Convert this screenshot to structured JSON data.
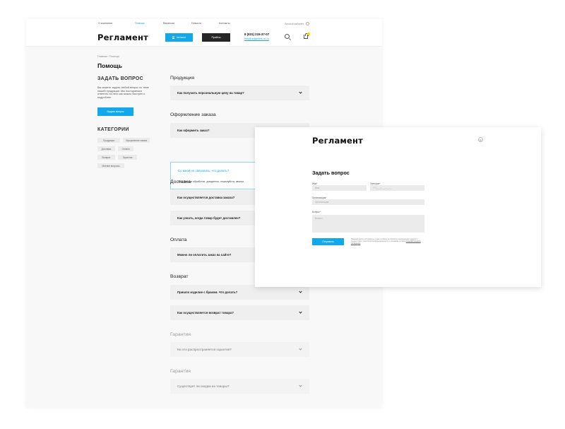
{
  "header": {
    "topnav": [
      "О компании",
      "Помощь",
      "Вакансии",
      "Новости",
      "Контакты"
    ],
    "cabinet": "Личный кабинет",
    "logo": "Регламент",
    "catalog_btn": "Каталог",
    "price_btn": "Прайсы",
    "phone": "8 (831) 215-37-07",
    "email": "info@reglament-nn.ru",
    "accent_color": "#12a9ec"
  },
  "breadcrumb": "Главная › Помощь",
  "page_title": "Помощь",
  "sidebar": {
    "ask_title": "ЗАДАТЬ ВОПРОС",
    "ask_text": "Вы можете задать любой вопрос по теме нашей продукции. Мы постараемся ответить на него как можно быстрее и подробнее.",
    "ask_button": "Задать вопрос",
    "categories_title": "КАТЕГОРИИ",
    "categories": [
      "Продукция",
      "Оформление заказа",
      "Доставка",
      "Оплата",
      "Возврат",
      "Гарантия",
      "Мнение вопросы"
    ]
  },
  "faq": {
    "sections": [
      {
        "title": "Продукция",
        "items": [
          "Как получить персональную цену на товар?"
        ]
      },
      {
        "title": "Оформление заказа",
        "items": [
          "Как оформить заказ?"
        ]
      },
      {
        "title": "Доставка",
        "items": [
          "Как осуществляется доставка заказа?",
          "Как узнать, когда товар будет доставлен?"
        ]
      },
      {
        "title": "Оплата",
        "items": [
          "Можно ли оплатить заказ на сайте?"
        ]
      },
      {
        "title": "Возврат",
        "items": [
          "Пришло изделие с браком. Что делать?",
          "Как осуществляется возврат товара?"
        ]
      },
      {
        "title": "Гарантия",
        "items": [
          "На что распространяется гарантия?"
        ]
      },
      {
        "title": "Гарантия",
        "items": [
          "Существует ли скидки на товары?"
        ]
      }
    ],
    "open_question": "Со мной не связались, что делать?",
    "open_answer": "Ваш заказ в обработке, дождитесь, пожалуйста, звонка"
  },
  "modal": {
    "logo": "Регламент",
    "title": "Задать вопрос",
    "name_label": "Имя*",
    "name_placeholder": "Имя",
    "phone_label": "Телефон*",
    "phone_placeholder": "+7 (___) ___-__-__",
    "org_label": "Организация*",
    "org_placeholder": "Организация",
    "question_label": "Вопрос*",
    "question_placeholder": "Вопрос",
    "send_button": "Отправить",
    "consent_text": "Нажимая кнопку «Отправить» я даю согласие на обработку персональных данных в соответствии с политикой конфиденциальности и принимаю условия",
    "consent_link": "пользовательского соглашения"
  }
}
